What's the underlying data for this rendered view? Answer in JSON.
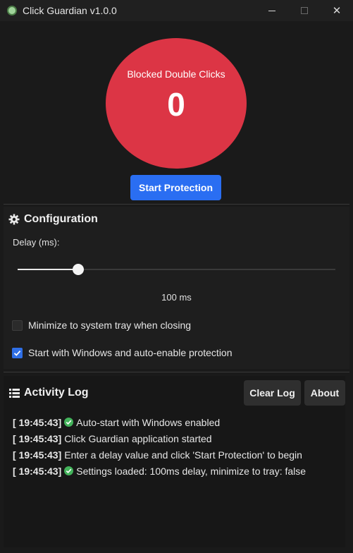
{
  "window": {
    "title": "Click Guardian v1.0.0"
  },
  "counter": {
    "label": "Blocked Double Clicks",
    "value": "0",
    "color": "#dc3545"
  },
  "start_button": {
    "label": "Start Protection",
    "color": "#2a6ef2"
  },
  "config": {
    "title": "Configuration",
    "delay_label": "Delay (ms):",
    "delay_fraction": 0.19,
    "delay_value": "100 ms",
    "options": [
      {
        "label": "Minimize to system tray when closing",
        "checked": false
      },
      {
        "label": "Start with Windows and auto-enable protection",
        "checked": true
      }
    ]
  },
  "log": {
    "title": "Activity Log",
    "clear_label": "Clear Log",
    "about_label": "About",
    "entries": [
      {
        "time": "[ 19:45:43]",
        "ok": true,
        "text": "Auto-start with Windows enabled"
      },
      {
        "time": "[ 19:45:43]",
        "ok": false,
        "text": "Click Guardian application started"
      },
      {
        "time": "[ 19:45:43]",
        "ok": false,
        "text": "Enter a delay value and click 'Start Protection' to begin"
      },
      {
        "time": "[ 19:45:43]",
        "ok": true,
        "text": "Settings loaded: 100ms delay, minimize to tray: false"
      }
    ]
  },
  "icons": {
    "app": "shield-app-icon",
    "config": "gear-icon",
    "log": "list-icon",
    "ok": "check-circle-icon"
  }
}
